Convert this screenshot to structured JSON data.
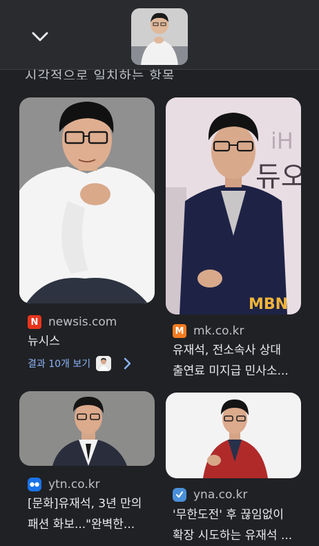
{
  "header": {
    "partial_title": "시각적으로 일치하는 항목"
  },
  "results": [
    {
      "source": "newsis.com",
      "favicon": "N",
      "favicon_color": "#e8341c",
      "caption_lines": [
        "뉴시스"
      ]
    },
    {
      "source": "mk.co.kr",
      "favicon": "M",
      "favicon_color": "#f47b20",
      "caption_lines": [
        "유재석, 전소속사 상대",
        "출연료 미지급 민사소..."
      ]
    },
    {
      "source": "ytn.co.kr",
      "favicon": "ytn-logo-icon",
      "favicon_color": "#1a73e8",
      "caption_lines": [
        "[문화]유재석, 3년 만의",
        "패션 화보...\"완벽한..."
      ]
    },
    {
      "source": "yna.co.kr",
      "favicon": "yna-logo-icon",
      "favicon_color": "#4a90d9",
      "caption_lines": [
        "'무한도전' 후 끊임없이",
        "확장 시도하는 유재석 ..."
      ]
    }
  ],
  "more_results": {
    "label": "결과 10개 보기"
  },
  "watermarks": {
    "mbn": "MBN"
  },
  "colors": {
    "background": "#202124",
    "link": "#8ab4f8",
    "text": "#e8eaed",
    "muted": "#bdc1c6"
  }
}
